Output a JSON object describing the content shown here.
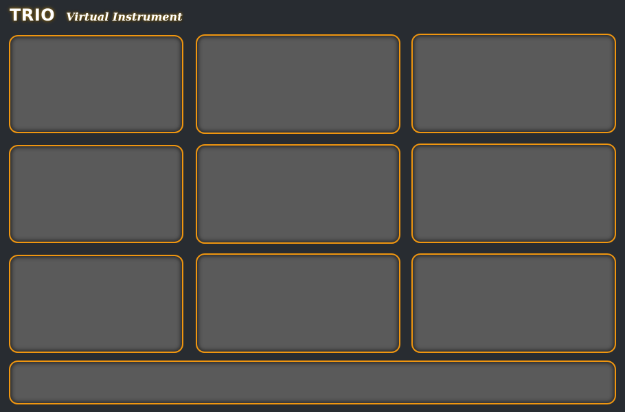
{
  "header": {
    "brand": "TRIO",
    "subtitle": "Virtual Instrument"
  },
  "colors": {
    "background": "#282c31",
    "panel_fill": "#5a5a5a",
    "panel_border": "#f0960f",
    "title_text": "#ffffff"
  },
  "panels": [
    {
      "id": "panel-r1-c1"
    },
    {
      "id": "panel-r1-c2"
    },
    {
      "id": "panel-r1-c3"
    },
    {
      "id": "panel-r2-c1"
    },
    {
      "id": "panel-r2-c2"
    },
    {
      "id": "panel-r2-c3"
    },
    {
      "id": "panel-r3-c1"
    },
    {
      "id": "panel-r3-c2"
    },
    {
      "id": "panel-r3-c3"
    },
    {
      "id": "panel-bottom-bar"
    }
  ]
}
